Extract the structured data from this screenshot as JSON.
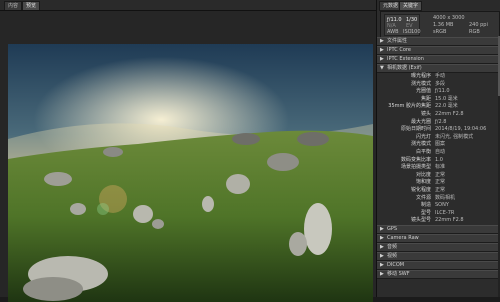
{
  "tabs": [
    "内容",
    "预览"
  ],
  "panel_tabs": [
    "元数据",
    "关键字"
  ],
  "info": {
    "exposure": "ƒ/11.0",
    "shutter": "1/30",
    "na": "N/A",
    "ev": "EV",
    "awb": "AWB",
    "iso_label": "ISO",
    "iso_value": "100",
    "dims": "4000 x 3000",
    "size": "1.36 MB",
    "dpi": "240 ppi",
    "color": "RGB",
    "colorspace": "sRGB"
  },
  "sections_top": [
    "文件属性",
    "IPTC Core",
    "IPTC Extension",
    "相机数据 (Exif)"
  ],
  "exif": [
    {
      "k": "曝光程序",
      "v": "手动"
    },
    {
      "k": "测光模式",
      "v": "多段"
    },
    {
      "k": "光圈值",
      "v": "ƒ/11.0"
    },
    {
      "k": "焦距",
      "v": "15.0 毫米"
    },
    {
      "k": "35mm 胶片的焦距",
      "v": "22.0 毫米"
    },
    {
      "k": "镜头",
      "v": "22mm F2.8"
    },
    {
      "k": "最大光圈",
      "v": "ƒ/2.8"
    },
    {
      "k": "原始日期时间",
      "v": "2014/8/19, 19:04:06"
    },
    {
      "k": "闪光灯",
      "v": "未闪光, 强制模式"
    },
    {
      "k": "测光模式",
      "v": "图案"
    },
    {
      "k": "白平衡",
      "v": "自动"
    },
    {
      "k": "数码变焦比率",
      "v": "1.0"
    },
    {
      "k": "场景拍摄类型",
      "v": "标准"
    },
    {
      "k": "对比度",
      "v": "正常"
    },
    {
      "k": "饱和度",
      "v": "正常"
    },
    {
      "k": "锐化程度",
      "v": "正常"
    },
    {
      "k": "文件源",
      "v": "数码相机"
    },
    {
      "k": "制造",
      "v": "SONY"
    },
    {
      "k": "型号",
      "v": "ILCE-7R"
    },
    {
      "k": "镜头型号",
      "v": "22mm F2.8"
    }
  ],
  "sections_bottom": [
    "GPS",
    "Camera Raw",
    "音频",
    "视频",
    "DICOM",
    "移动 SWF"
  ],
  "colors": {
    "panel": "#2c2c2c",
    "section": "#3a3a3a"
  }
}
